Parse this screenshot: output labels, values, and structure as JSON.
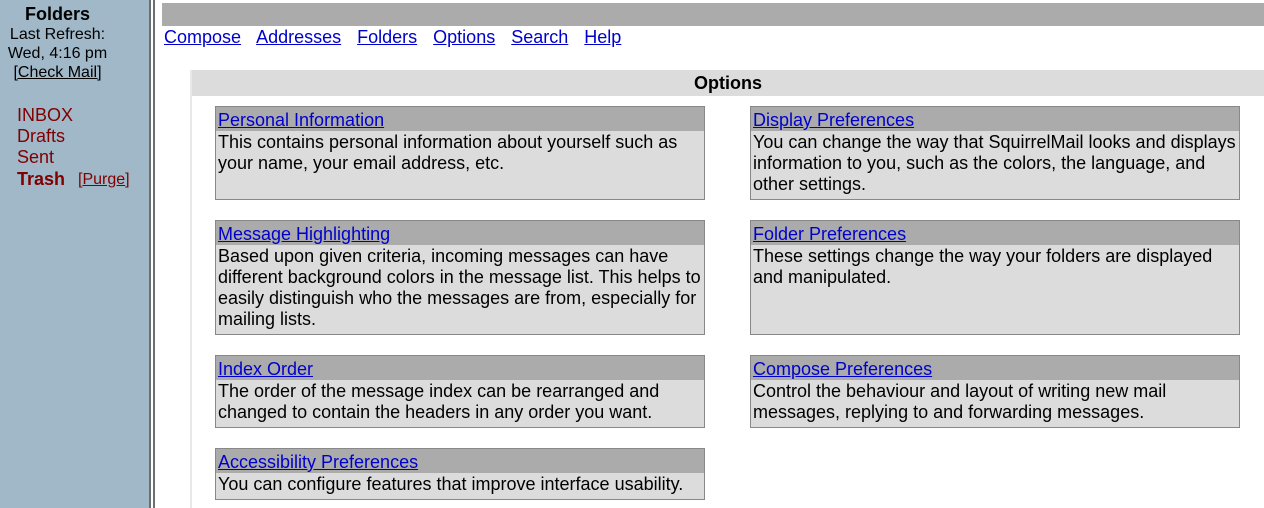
{
  "sidebar": {
    "title": "Folders",
    "refresh_label": "Last Refresh:",
    "refresh_time": "Wed, 4:16 pm",
    "check_mail": "[Check Mail]",
    "folders": [
      {
        "label": "INBOX"
      },
      {
        "label": "Drafts"
      },
      {
        "label": "Sent"
      },
      {
        "label": "Trash"
      }
    ],
    "purge_open": "[",
    "purge_label": "Purge",
    "purge_close": "]"
  },
  "nav": {
    "compose": "Compose",
    "addresses": "Addresses",
    "folders": "Folders",
    "options": "Options",
    "search": "Search",
    "help": "Help"
  },
  "options": {
    "title": "Options",
    "items": [
      {
        "title": "Personal Information",
        "desc": "This contains personal information about yourself such as your name, your email address, etc."
      },
      {
        "title": "Display Preferences",
        "desc": "You can change the way that SquirrelMail looks and displays information to you, such as the colors, the language, and other settings."
      },
      {
        "title": "Message Highlighting",
        "desc": "Based upon given criteria, incoming messages can have different background colors in the message list. This helps to easily distinguish who the messages are from, especially for mailing lists."
      },
      {
        "title": "Folder Preferences",
        "desc": "These settings change the way your folders are displayed and manipulated."
      },
      {
        "title": "Index Order",
        "desc": "The order of the message index can be rearranged and changed to contain the headers in any order you want."
      },
      {
        "title": "Compose Preferences",
        "desc": "Control the behaviour and layout of writing new mail messages, replying to and forwarding messages."
      },
      {
        "title": "Accessibility Preferences",
        "desc": "You can configure features that improve interface usability."
      }
    ]
  }
}
